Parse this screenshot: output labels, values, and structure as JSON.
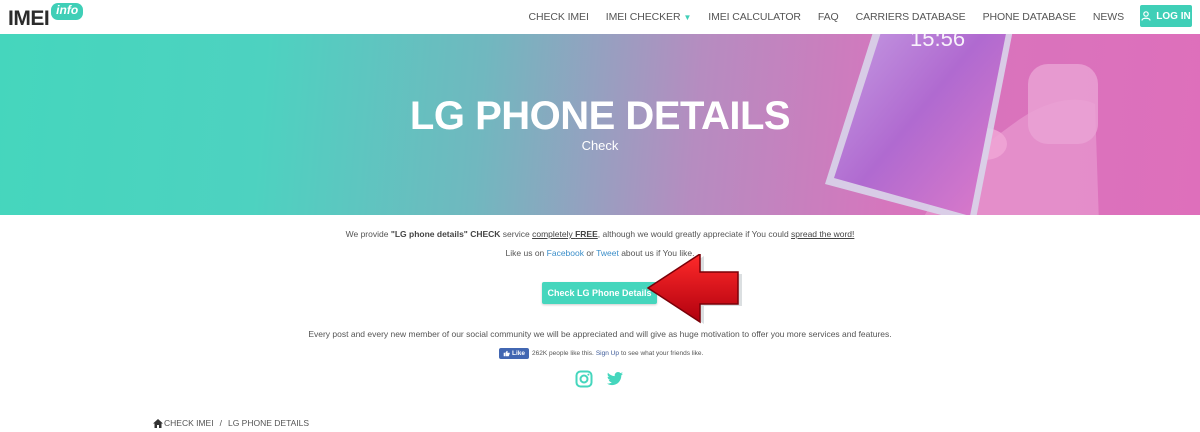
{
  "colors": {
    "accent": "#45d6bd",
    "hero_left": "#45d6bd",
    "hero_right": "#de6fbb",
    "arrow": "#d0021b",
    "facebook": "#4267b2"
  },
  "nav": {
    "logo_text": "IMEI",
    "logo_badge": "info",
    "items": [
      {
        "label": "CHECK IMEI"
      },
      {
        "label": "IMEI CHECKER"
      },
      {
        "label": "IMEI CALCULATOR"
      },
      {
        "label": "FAQ"
      },
      {
        "label": "CARRIERS DATABASE"
      },
      {
        "label": "PHONE DATABASE"
      },
      {
        "label": "NEWS"
      }
    ],
    "login_label": "LOG IN",
    "login_icon": "user-icon"
  },
  "hero": {
    "title": "LG PHONE DETAILS",
    "subtitle": "Check",
    "phone_time": "15:56"
  },
  "content": {
    "line1": {
      "p1": "We provide ",
      "service": "\"LG phone details\" CHECK",
      "p2": " service ",
      "free_pre": "completely ",
      "free": "FREE",
      "p3": ", although we would greatly appreciate if You could ",
      "spread": "spread the word!"
    },
    "line2": {
      "p1": "Like us on ",
      "facebook": "Facebook",
      "p2": " or ",
      "tweet": "Tweet",
      "p3": " about us if You like."
    },
    "cta_label": "Check LG Phone Details",
    "community": "Every post and every new member of our social community we will be appreciated and will give as huge motivation to offer you more services and features.",
    "fb": {
      "like_label": "Like",
      "count_text": "262K people like this.",
      "signup": "Sign Up",
      "rest": "to see what your friends like."
    },
    "social_icons": [
      "instagram-icon",
      "twitter-icon"
    ]
  },
  "breadcrumb": {
    "home": "CHECK IMEI",
    "separator": "/",
    "current": "LG PHONE DETAILS"
  }
}
